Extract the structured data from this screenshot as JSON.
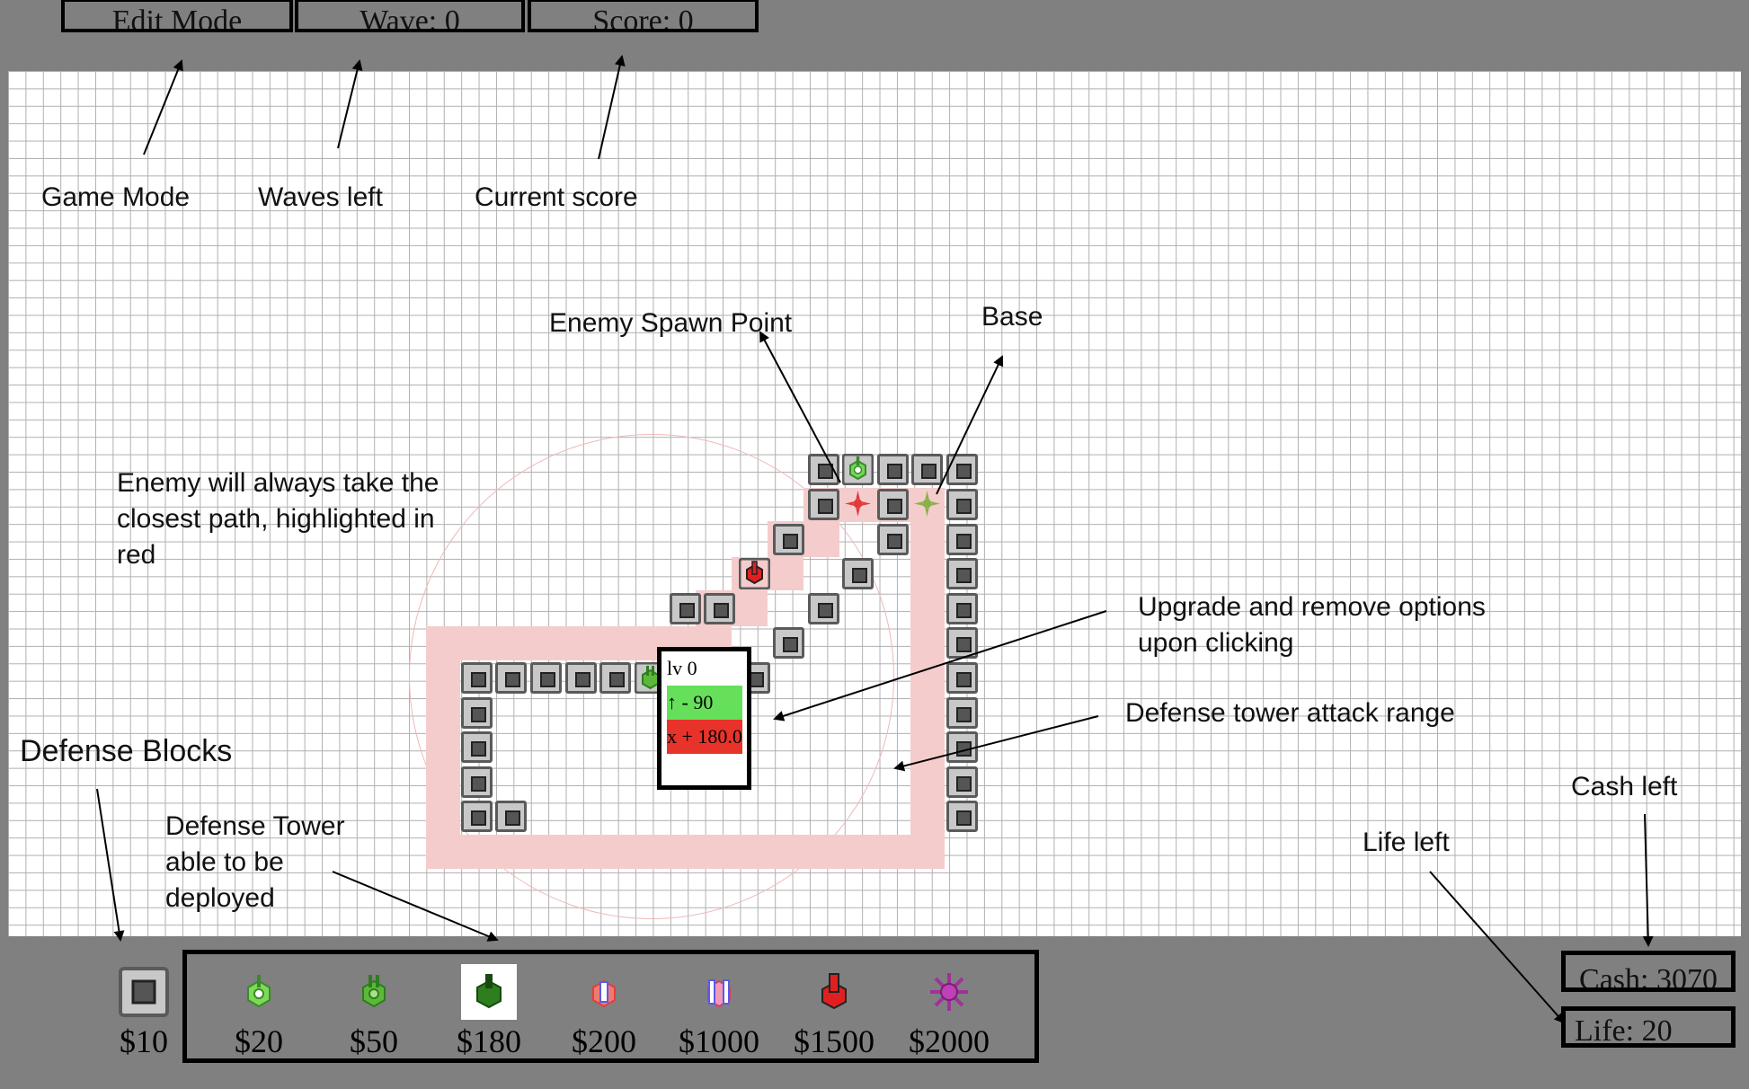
{
  "hud": {
    "mode": "Edit Mode",
    "wave": "Wave: 0",
    "score": "Score: 0",
    "cash": "Cash: 3070",
    "life": "Life: 20"
  },
  "popup": {
    "level": "lv 0",
    "upgrade": "↑ - 90",
    "remove": "x + 180.0"
  },
  "annotations": {
    "game_mode": "Game Mode",
    "waves_left": "Waves left",
    "current_score": "Current score",
    "spawn_point": "Enemy Spawn Point",
    "base": "Base",
    "enemy_path": "Enemy will always take the\nclosest path, highlighted in\nred",
    "upgrade_remove": "Upgrade and remove options\nupon clicking",
    "attack_range": "Defense tower attack range",
    "defense_blocks": "Defense Blocks",
    "defense_tower": "Defense Tower\nable to be\ndeployed",
    "cash_left": "Cash left",
    "life_left": "Life left"
  },
  "shop": {
    "block_price": "$10",
    "towers": [
      {
        "name": "basic-tower-icon",
        "price": "$20",
        "color": "#7ed957"
      },
      {
        "name": "double-tower-icon",
        "price": "$50",
        "color": "#5cb83a"
      },
      {
        "name": "heavy-tower-icon",
        "price": "$180",
        "color": "#2e7d1e"
      },
      {
        "name": "ice-tower-icon",
        "price": "$200",
        "color": "#e0403a"
      },
      {
        "name": "laser-tower-icon",
        "price": "$1000",
        "color": "#5a5ae6"
      },
      {
        "name": "cannon-tower-icon",
        "price": "$1500",
        "color": "#e02020"
      },
      {
        "name": "star-tower-icon",
        "price": "$2000",
        "color": "#a0309a"
      }
    ]
  },
  "colors": {
    "frame": "#808080",
    "path": "#f5cccc",
    "upgrade_bg": "#66e05a",
    "remove_bg": "#e8332a"
  }
}
